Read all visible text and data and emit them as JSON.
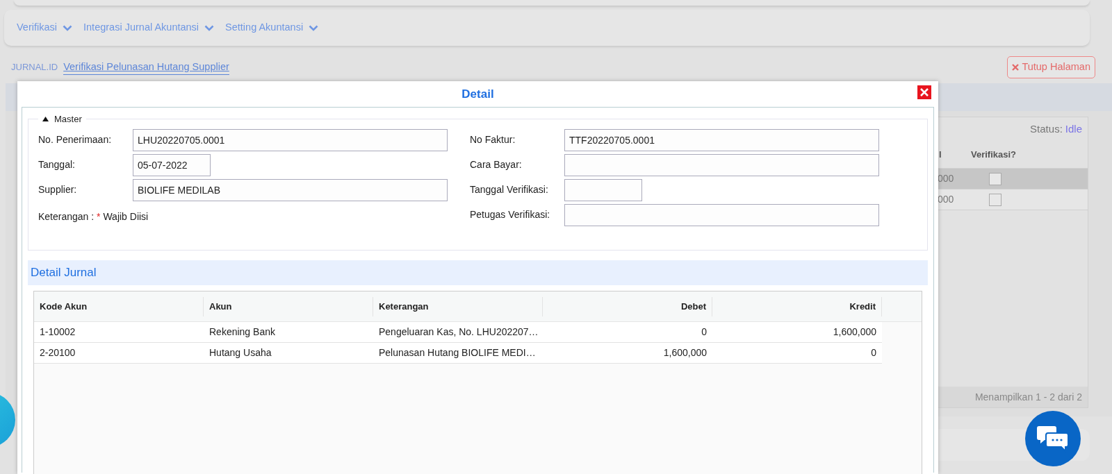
{
  "nav_menu": [
    {
      "label": "Verifikasi"
    },
    {
      "label": "Integrasi Jurnal Akuntansi"
    },
    {
      "label": "Setting Akuntansi"
    }
  ],
  "breadcrumb": {
    "root": "JURNAL.ID",
    "current": "Verifikasi Pelunasan Hutang Supplier"
  },
  "close_page_button": {
    "label": "Tutup Halaman"
  },
  "background_grid": {
    "status_label": "Status:",
    "status_value": "Idle",
    "columns": [
      "l",
      "Verifikasi?"
    ],
    "rows": [
      {
        "column_1": "000",
        "checked": false,
        "selected": true
      },
      {
        "column_1": "000",
        "checked": false,
        "selected": false
      }
    ],
    "footer": "Menampilkan 1 - 2 dari 2"
  },
  "modal": {
    "title": "Detail",
    "master": {
      "legend": "Master",
      "expanded": true,
      "left_fields": [
        {
          "label": "No. Penerimaan:",
          "value": "LHU20220705.0001",
          "kind": "wide"
        },
        {
          "label": "Tanggal:",
          "value": "05-07-2022",
          "kind": "short"
        },
        {
          "label": "Supplier:",
          "value": "BIOLIFE MEDILAB",
          "kind": "wide"
        }
      ],
      "note": {
        "label": "Keterangan :",
        "required_mark": "*",
        "required_text": "Wajib Diisi"
      },
      "right_fields": [
        {
          "label": "No Faktur:",
          "value": "TTF20220705.0001",
          "kind": "wide"
        },
        {
          "label": "Cara Bayar:",
          "kind": "wide"
        },
        {
          "label": "Tanggal Verifikasi:",
          "kind": "short"
        },
        {
          "label": "Petugas Verifikasi:",
          "kind": "wide"
        }
      ]
    },
    "detail_jurnal": {
      "title": "Detail Jurnal",
      "columns": [
        "Kode Akun",
        "Akun",
        "Keterangan",
        "Debet",
        "Kredit"
      ],
      "rows": [
        [
          "1-10002",
          "Rekening Bank",
          "Pengeluaran Kas, No. LHU202207…",
          "0",
          "1,600,000"
        ],
        [
          "2-20100",
          "Hutang Usaha",
          "Pelunasan Hutang BIOLIFE MEDI…",
          "1,600,000",
          "0"
        ]
      ]
    }
  }
}
